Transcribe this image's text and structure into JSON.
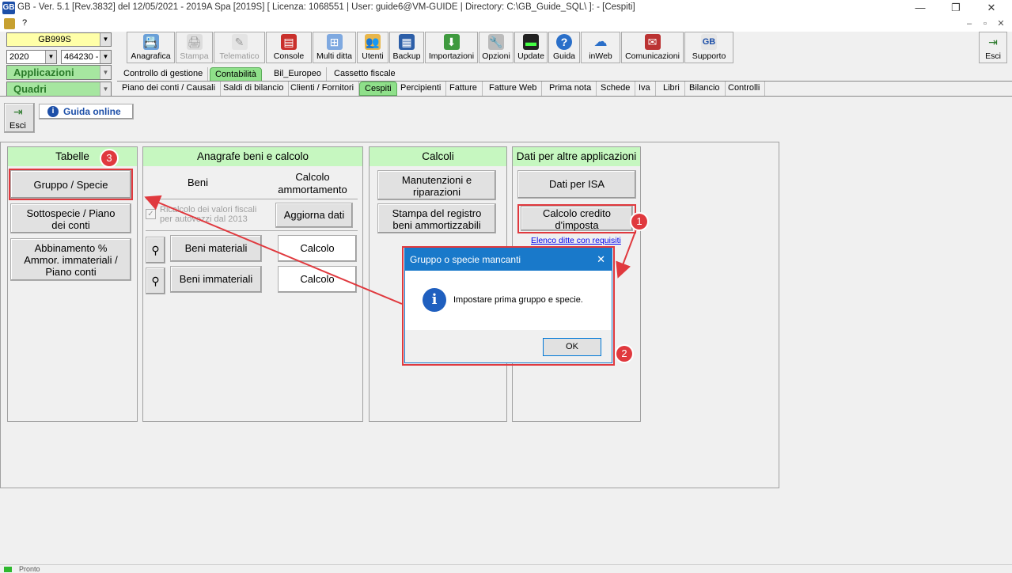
{
  "window": {
    "title": "GB - Ver. 5.1 [Rev.3832] del 12/05/2021 -  2019A Spa [2019S]   [ Licenza: 1068551 | User: guide6@VM-GUIDE | Directory: C:\\GB_Guide_SQL\\ ]: - [Cespiti]",
    "app_icon": "GB",
    "minimize": "—",
    "restore": "❐",
    "close": "✕",
    "menu_help": "?"
  },
  "selectors": {
    "company": "GB999S",
    "year": "2020",
    "code": "464230 -",
    "applicazioni": "Applicazioni",
    "quadri": "Quadri"
  },
  "toolbar": [
    {
      "label": "Anagrafica",
      "icon": "📇"
    },
    {
      "label": "Stampa",
      "icon": "🖨"
    },
    {
      "label": "Telematico",
      "icon": "✎"
    },
    {
      "label": "Console",
      "icon": "▤"
    },
    {
      "label": "Multi ditta",
      "icon": "⊞"
    },
    {
      "label": "Utenti",
      "icon": "👥"
    },
    {
      "label": "Backup",
      "icon": "▦"
    },
    {
      "label": "Importazioni",
      "icon": "⬇"
    },
    {
      "label": "Opzioni",
      "icon": "🔧"
    },
    {
      "label": "Update",
      "icon": "▬"
    },
    {
      "label": "Guida",
      "icon": "?"
    },
    {
      "label": "inWeb",
      "icon": "☁"
    },
    {
      "label": "Comunicazioni",
      "icon": "✉"
    },
    {
      "label": "Supporto",
      "icon": "GB"
    }
  ],
  "toolbar_exit": "Esci",
  "tabs_app": [
    "Controllo di gestione",
    "Contabilità",
    "Bil_Europeo",
    "Cassetto fiscale"
  ],
  "tabs_quadri": [
    "Piano dei conti / Causali",
    "Saldi di bilancio",
    "Clienti / Fornitori",
    "Cespiti",
    "Percipienti",
    "Fatture",
    "Fatture Web",
    "Prima nota",
    "Schede",
    "Iva",
    "Libri",
    "Bilancio",
    "Controlli"
  ],
  "page": {
    "exit": "Esci",
    "guida_online": "Guida online",
    "tabelle": {
      "header": "Tabelle",
      "gruppo": "Gruppo / Specie",
      "sottospecie_1": "Sottospecie / Piano",
      "sottospecie_2": "dei conti",
      "abbinamento_1": "Abbinamento %",
      "abbinamento_2": "Ammor. immateriali /",
      "abbinamento_3": "Piano conti"
    },
    "anagrafe": {
      "header": "Anagrafe beni e calcolo",
      "beni": "Beni",
      "calcolo_amm_1": "Calcolo",
      "calcolo_amm_2": "ammortamento",
      "ricalcolo_1": "Ricalcolo dei valori fiscali",
      "ricalcolo_2": "per autovezzi dal 2013",
      "aggiorna": "Aggiorna dati",
      "beni_materiali": "Beni materiali",
      "beni_immateriali": "Beni immateriali",
      "calcolo": "Calcolo"
    },
    "calcoli": {
      "header": "Calcoli",
      "manutenzioni_1": "Manutenzioni e",
      "manutenzioni_2": "riparazioni",
      "stampa_1": "Stampa del registro",
      "stampa_2": "beni ammortizzabili"
    },
    "dati": {
      "header": "Dati per altre applicazioni",
      "isa": "Dati per ISA",
      "credito_1": "Calcolo credito",
      "credito_2": "d'imposta",
      "elenco": "Elenco ditte con requisiti"
    }
  },
  "dialog": {
    "title": "Gruppo o specie mancanti",
    "message": "Impostare prima gruppo e specie.",
    "ok": "OK",
    "close": "✕"
  },
  "badges": [
    "1",
    "2",
    "3"
  ],
  "status": "Pronto",
  "colors": {
    "accent_green": "#c6f7c0",
    "tab_selected": "#8fe08a",
    "annotation_red": "#e0393e",
    "dialog_blue": "#1979ca"
  }
}
